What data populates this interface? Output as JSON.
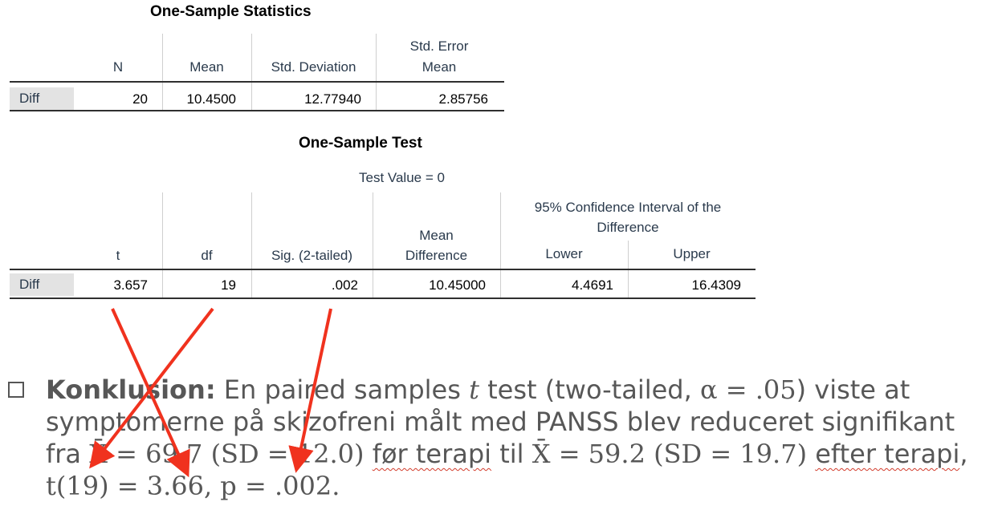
{
  "stats_table": {
    "title": "One-Sample Statistics",
    "headers": {
      "n": "N",
      "mean": "Mean",
      "sd": "Std. Deviation",
      "se_line1": "Std. Error",
      "se_line2": "Mean"
    },
    "row": {
      "label": "Diff",
      "n": "20",
      "mean": "10.4500",
      "sd": "12.77940",
      "se": "2.85756"
    }
  },
  "test_table": {
    "title": "One-Sample Test",
    "test_value": "Test Value = 0",
    "headers": {
      "t": "t",
      "df": "df",
      "sig": "Sig. (2-tailed)",
      "md_line1": "Mean",
      "md_line2": "Difference",
      "ci_line1": "95% Confidence Interval of the",
      "ci_line2": "Difference",
      "lower": "Lower",
      "upper": "Upper"
    },
    "row": {
      "label": "Diff",
      "t": "3.657",
      "df": "19",
      "sig": ".002",
      "md": "10.45000",
      "lower": "4.4691",
      "upper": "16.4309"
    }
  },
  "conclusion": {
    "heading": "Konklusion:",
    "line1": " En paired samples ",
    "t_symbol": "t",
    "line1b": " test (two-tailed, ",
    "alpha": "α = .05",
    "line1c": ") viste at",
    "line2": "symptomerne på skizofreni målt med PANSS blev reduceret signifikant",
    "line3a": "fra ",
    "stat1": "X̄ = 69.7 (SD = 12.0)",
    "line3b": "før terapi",
    "line3c": " til ",
    "stat2": "X̄ = 59.2 (SD = 19.7)",
    "line3d": "efter terapi",
    "line3e": ",",
    "line4": "t(19) = 3.66, p = .002."
  },
  "colors": {
    "arrow": "#f0321e",
    "header_text": "#2a3a4c",
    "label_bg": "#e3e3e3",
    "conclusion_text": "#575757"
  }
}
